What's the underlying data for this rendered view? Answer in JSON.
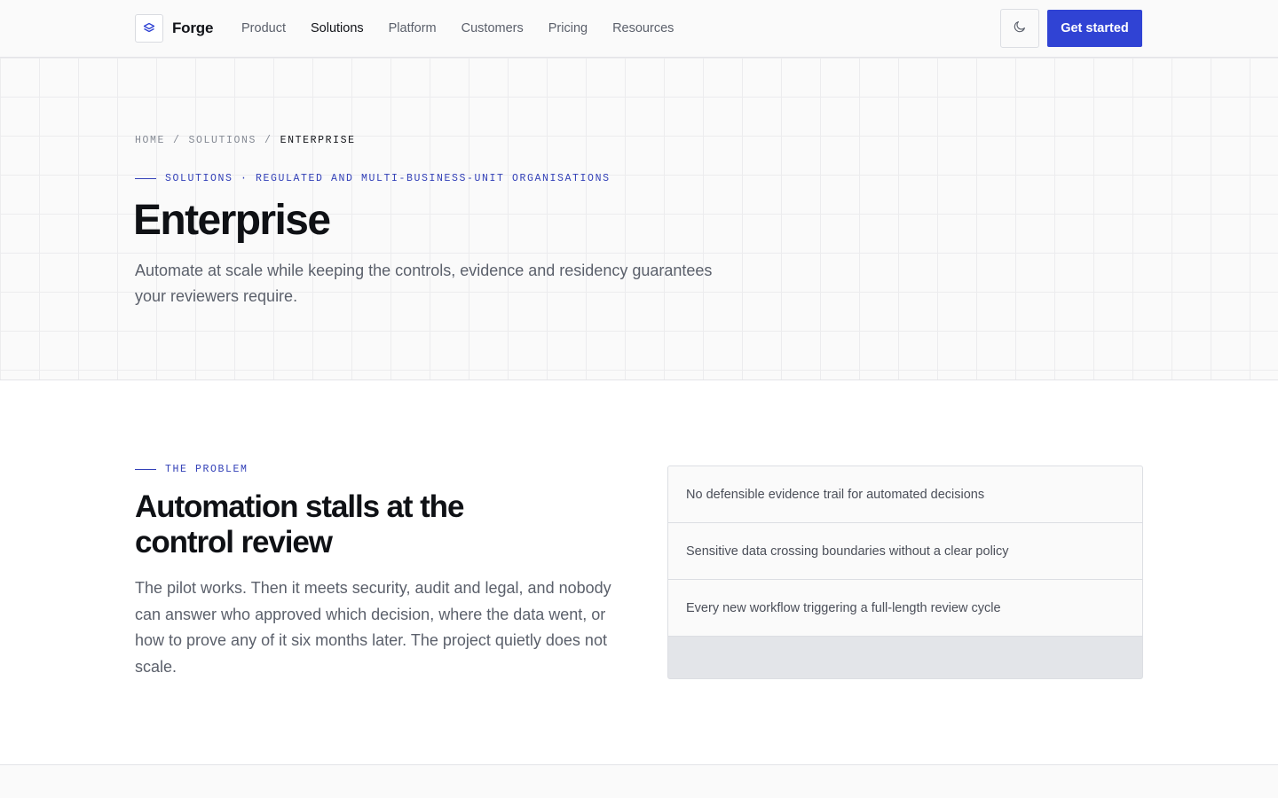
{
  "header": {
    "brand": "Forge",
    "nav": [
      {
        "label": "Product"
      },
      {
        "label": "Solutions"
      },
      {
        "label": "Platform"
      },
      {
        "label": "Customers"
      },
      {
        "label": "Pricing"
      },
      {
        "label": "Resources"
      }
    ],
    "active_nav": "Solutions",
    "cta_label": "Get started",
    "icons": {
      "logo": "layers-icon",
      "theme_toggle": "moon-icon"
    }
  },
  "hero": {
    "breadcrumb": [
      "HOME",
      "SOLUTIONS",
      "ENTERPRISE"
    ],
    "breadcrumb_separator": "/",
    "eyebrow": "SOLUTIONS · REGULATED AND MULTI-BUSINESS-UNIT ORGANISATIONS",
    "title": "Enterprise",
    "subtitle": "Automate at scale while keeping the controls, evidence and residency guarantees your reviewers require."
  },
  "problem": {
    "eyebrow": "THE PROBLEM",
    "title": "Automation stalls at the control review",
    "body": "The pilot works. Then it meets security, audit and legal, and nobody can answer who approved which decision, where the data went, or how to prove any of it six months later. The project quietly does not scale.",
    "issues": [
      "No defensible evidence trail for automated decisions",
      "Sensitive data crossing boundaries without a clear policy",
      "Every new workflow triggering a full-length review cycle"
    ]
  },
  "colors": {
    "accent": "#3043d4",
    "eyebrow": "#3341b8",
    "text": "#0f1115",
    "muted": "#5b606b"
  }
}
